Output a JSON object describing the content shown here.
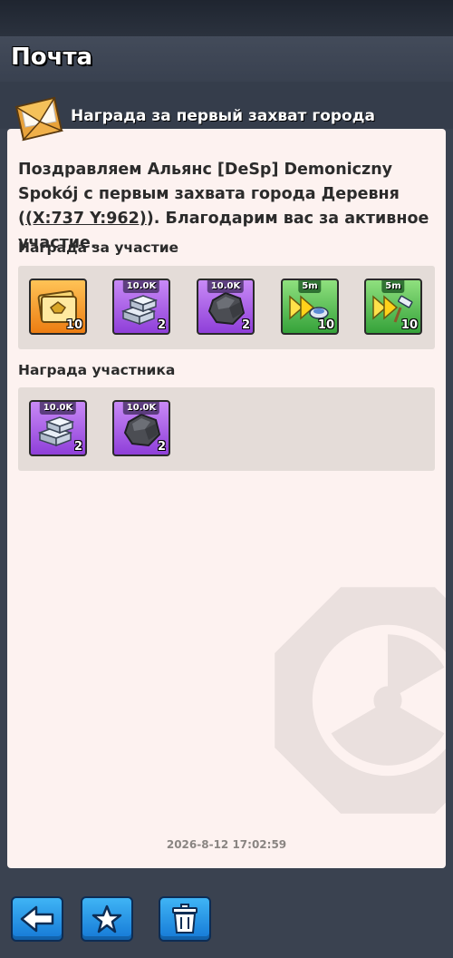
{
  "header": {
    "title": "Почта"
  },
  "mail": {
    "subject": "Награда за первый захват города",
    "message_before": "Поздравляем Альянс [DeSp] Demoniczny Spokój с первым захвата города Деревня (",
    "message_coord": "(X:737 Y:962)",
    "message_after": "). Благодарим вас за активное участие.",
    "timestamp": "2026-8-12 17:02:59"
  },
  "participation_reward": {
    "label": "Награда за участие",
    "items": [
      {
        "icon": "gold-tickets-icon",
        "color": "orange",
        "badge": "",
        "qty": "10"
      },
      {
        "icon": "iron-ingots-icon",
        "color": "purple",
        "badge": "10.0K",
        "qty": "2"
      },
      {
        "icon": "stone-ore-icon",
        "color": "purple",
        "badge": "10.0K",
        "qty": "2"
      },
      {
        "icon": "speedup-research-icon",
        "color": "green",
        "badge": "5m",
        "qty": "10"
      },
      {
        "icon": "speedup-build-icon",
        "color": "green",
        "badge": "5m",
        "qty": "10"
      }
    ]
  },
  "participant_reward": {
    "label": "Награда участника",
    "items": [
      {
        "icon": "iron-ingots-icon",
        "color": "purple",
        "badge": "10.0K",
        "qty": "2"
      },
      {
        "icon": "stone-ore-icon",
        "color": "purple",
        "badge": "10.0K",
        "qty": "2"
      }
    ]
  },
  "footer": {
    "buttons": [
      {
        "icon": "back-arrow-icon"
      },
      {
        "icon": "star-icon"
      },
      {
        "icon": "trash-icon"
      }
    ]
  }
}
